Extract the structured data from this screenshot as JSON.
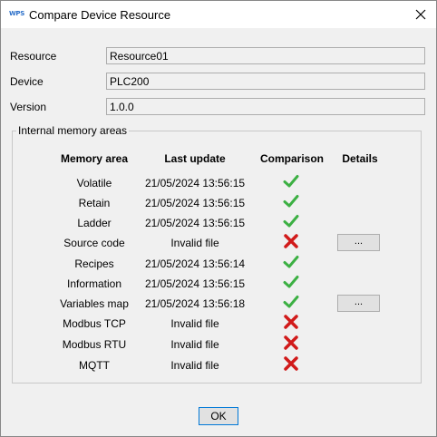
{
  "window": {
    "title": "Compare Device Resource",
    "app_icon_text": "WPS"
  },
  "fields": {
    "resource": {
      "label": "Resource",
      "value": "Resource01"
    },
    "device": {
      "label": "Device",
      "value": "PLC200"
    },
    "version": {
      "label": "Version",
      "value": "1.0.0"
    }
  },
  "memory": {
    "group_title": "Internal memory areas",
    "headers": {
      "area": "Memory area",
      "last_update": "Last update",
      "comparison": "Comparison",
      "details": "Details"
    },
    "rows": [
      {
        "area": "Volatile",
        "last_update": "21/05/2024 13:56:15",
        "comparison": "ok"
      },
      {
        "area": "Retain",
        "last_update": "21/05/2024 13:56:15",
        "comparison": "ok"
      },
      {
        "area": "Ladder",
        "last_update": "21/05/2024 13:56:15",
        "comparison": "ok"
      },
      {
        "area": "Source code",
        "last_update": "Invalid file",
        "comparison": "error",
        "details": "..."
      },
      {
        "area": "Recipes",
        "last_update": "21/05/2024 13:56:14",
        "comparison": "ok"
      },
      {
        "area": "Information",
        "last_update": "21/05/2024 13:56:15",
        "comparison": "ok"
      },
      {
        "area": "Variables map",
        "last_update": "21/05/2024 13:56:18",
        "comparison": "ok",
        "details": "..."
      },
      {
        "area": "Modbus TCP",
        "last_update": "Invalid file",
        "comparison": "error"
      },
      {
        "area": "Modbus RTU",
        "last_update": "Invalid file",
        "comparison": "error"
      },
      {
        "area": "MQTT",
        "last_update": "Invalid file",
        "comparison": "error"
      }
    ]
  },
  "buttons": {
    "ok": "OK"
  },
  "colors": {
    "check": "#3cb043",
    "cross": "#d11a1a",
    "ok_border": "#0078d7"
  }
}
